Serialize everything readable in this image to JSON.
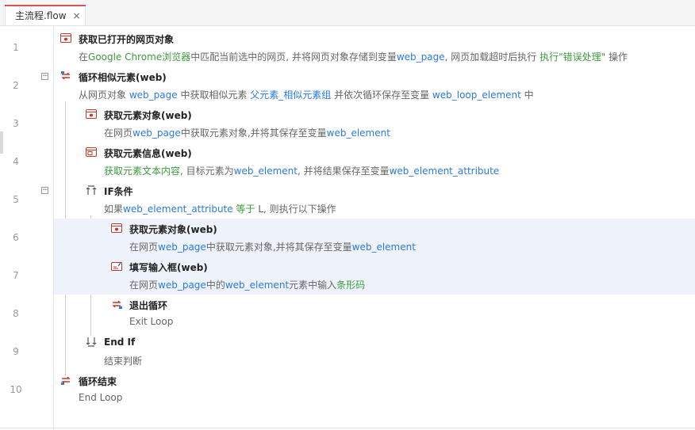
{
  "tab": {
    "label": "主流程.flow",
    "close": "×"
  },
  "rows": [
    {
      "num": "1",
      "title": "获取已打开的网页对象",
      "desc": [
        [
          "在"
        ],
        [
          "Google Chrome浏览器",
          "g"
        ],
        [
          "中匹配当前选中的网页, 并将网页对象存储到变量"
        ],
        [
          "web_page",
          "v"
        ],
        [
          ", 网页加载超时后执行 "
        ],
        [
          "执行\"错误处理\"",
          "g"
        ],
        [
          " 操作"
        ]
      ]
    },
    {
      "num": "2",
      "title": "循环相似元素(web)",
      "desc": [
        [
          "从网页对象 "
        ],
        [
          "web_page",
          "v"
        ],
        [
          " 中获取相似元素 "
        ],
        [
          "父元素_相似元素组",
          "v"
        ],
        [
          " 并依次循环保存至变量 "
        ],
        [
          "web_loop_element",
          "v"
        ],
        [
          " 中"
        ]
      ]
    },
    {
      "num": "3",
      "title": "获取元素对象(web)",
      "desc": [
        [
          "在网页"
        ],
        [
          "web_page",
          "v"
        ],
        [
          "中获取元素对象,并将其保存至变量"
        ],
        [
          "web_element",
          "v"
        ]
      ]
    },
    {
      "num": "4",
      "title": "获取元素信息(web)",
      "desc": [
        [
          "获取元素文本内容",
          "g"
        ],
        [
          ", 目标元素为"
        ],
        [
          "web_element",
          "v"
        ],
        [
          ", 并将结果保存至变量"
        ],
        [
          "web_element_attribute",
          "v"
        ]
      ]
    },
    {
      "num": "5",
      "title": "IF条件",
      "desc": [
        [
          "如果"
        ],
        [
          "web_element_attribute",
          "v"
        ],
        [
          " "
        ],
        [
          "等于",
          "g"
        ],
        [
          " L, 则执行以下操作"
        ]
      ]
    },
    {
      "num": "6",
      "title": "获取元素对象(web)",
      "desc": [
        [
          "在网页"
        ],
        [
          "web_page",
          "v"
        ],
        [
          "中获取元素对象,并将其保存至变量"
        ],
        [
          "web_element",
          "v"
        ]
      ]
    },
    {
      "num": "7",
      "title": "填写输入框(web)",
      "desc": [
        [
          "在网页"
        ],
        [
          "web_page",
          "v"
        ],
        [
          "中的"
        ],
        [
          "web_element",
          "v"
        ],
        [
          "元素中输入"
        ],
        [
          "条形码",
          "g"
        ]
      ]
    },
    {
      "num": "8",
      "title": "退出循环",
      "desc": [
        [
          "Exit Loop"
        ]
      ]
    },
    {
      "num": "9",
      "title": "End If",
      "desc": [
        [
          "结束判断"
        ]
      ]
    },
    {
      "num": "10",
      "title": "循环结束",
      "desc": [
        [
          "End Loop"
        ]
      ]
    }
  ],
  "fold_symbol": "−",
  "icons": [
    "browser-icon",
    "loop-icon",
    "element-icon",
    "element-info-icon",
    "if-icon",
    "element-icon",
    "input-icon",
    "exit-loop-icon",
    "end-if-icon",
    "loop-end-icon"
  ],
  "colors": {
    "variable": "#2a7ae2",
    "keyword": "#3d9b3d",
    "highlight": "#eef3fb",
    "tab_accent": "#d9534f"
  }
}
